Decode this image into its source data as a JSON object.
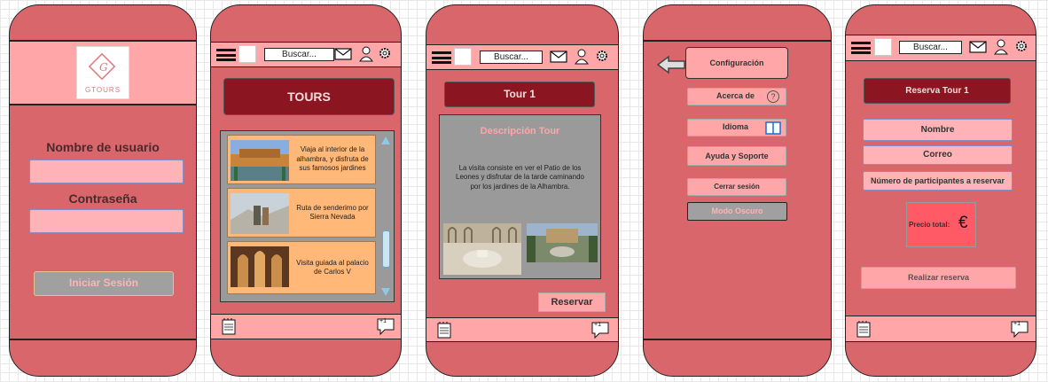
{
  "login": {
    "logo_text": "GTOURS",
    "username_label": "Nombre de usuario",
    "password_label": "Contraseña",
    "username_value": "",
    "password_value": "",
    "submit_label": "Iniciar Sesión"
  },
  "header": {
    "search_placeholder": "Buscar..."
  },
  "tours": {
    "title": "TOURS",
    "items": [
      {
        "text": "Viaja al interior de la alhambra, y disfruta de sus famosos jardines"
      },
      {
        "text": "Ruta de senderimo por Sierra Nevada"
      },
      {
        "text": "Visita guiada al palacio de Carlos V"
      }
    ]
  },
  "tour_detail": {
    "title": "Tour 1",
    "desc_heading": "Descripción Tour",
    "desc_text": "La visita consiste en ver el Patio de los Leones y disfrutar de la tarde caminando por los jardines de la Alhambra.",
    "reserve_label": "Reservar"
  },
  "settings": {
    "config_label": "Configuración",
    "about_label": "Acerca de",
    "about_icon": "?",
    "language_label": "Idioma",
    "support_label": "Ayuda y Soporte",
    "logout_label": "Cerrar sesión",
    "dark_mode_label": "Modo Oscuro"
  },
  "reservation": {
    "title": "Reserva Tour 1",
    "name_label": "Nombre",
    "email_label": "Correo",
    "participants_label": "Número de participantes a reservar",
    "price_label": "Precio total:",
    "currency": "€",
    "submit_label": "Realizar reserva"
  },
  "footer": {
    "badge": "+1"
  },
  "colors": {
    "phone_bg": "#d9666b",
    "bar_bg": "#ffa6a9",
    "dark_button": "#8b1520",
    "card_bg": "#ffb877"
  },
  "icons": [
    "menu-icon",
    "logo-icon",
    "mail-icon",
    "user-icon",
    "gear-icon",
    "notepad-icon",
    "chat-icon",
    "back-arrow-icon",
    "help-icon",
    "book-icon",
    "euro-icon"
  ]
}
